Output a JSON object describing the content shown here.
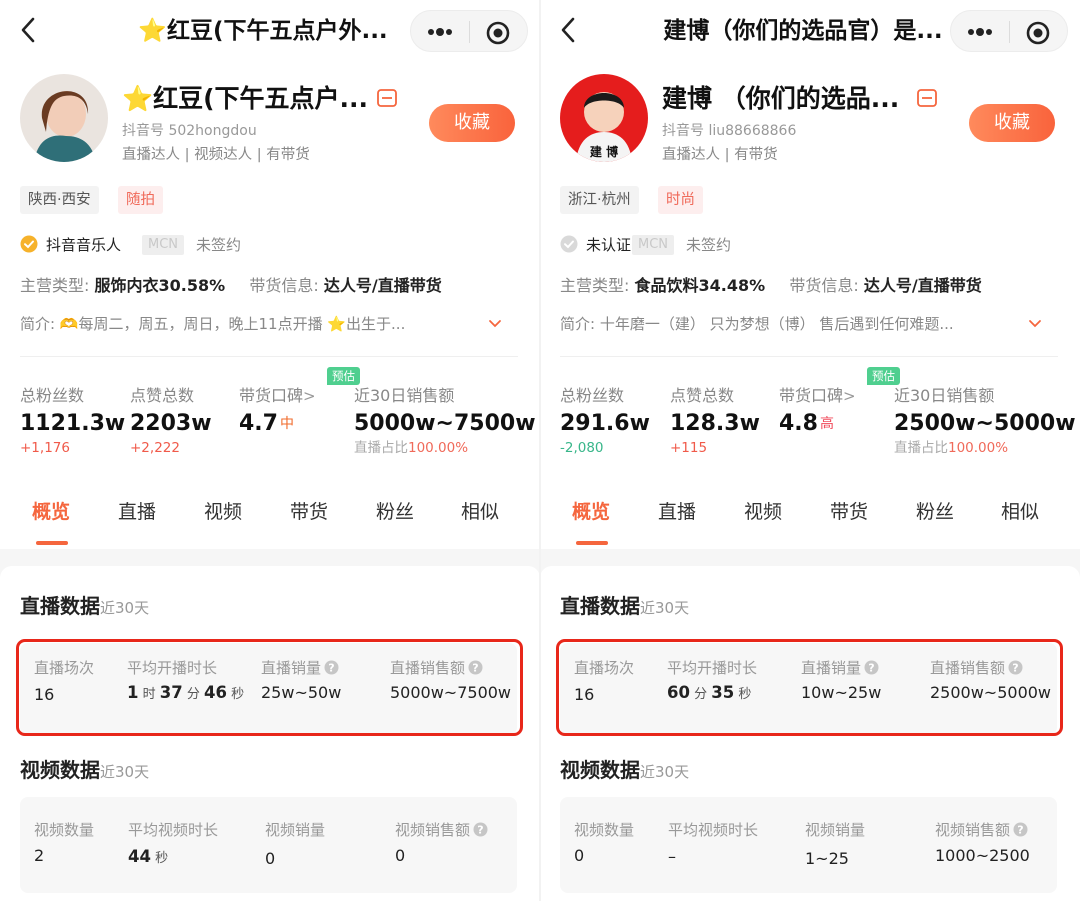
{
  "left": {
    "nav": {
      "title": "⭐红豆(下午五点户外..."
    },
    "profile": {
      "name": "⭐红豆(下午五点户...",
      "douyin_id": "抖音号 502hongdou",
      "roles": "直播达人 | 视频达人 | 有带货",
      "collect_label": "收藏"
    },
    "tags": [
      {
        "label": "陕西·西安",
        "style": "gray"
      },
      {
        "label": "随拍",
        "style": "pink"
      }
    ],
    "certification": {
      "label": "抖音音乐人",
      "verified": true,
      "mcn_badge": "MCN",
      "mcn_status": "未签约"
    },
    "main_category": {
      "label": "主营类型:",
      "value": "服饰内衣30.58%"
    },
    "sales_info": {
      "label": "带货信息:",
      "value": "达人号/直播带货"
    },
    "bio": "简介: 🫶每周二，周五，周日，晚上11点开播 ⭐出生于...",
    "stats": {
      "followers": {
        "label": "总粉丝数",
        "value": "1121.3w",
        "delta": "+1,176",
        "trend": "up"
      },
      "likes": {
        "label": "点赞总数",
        "value": "2203w",
        "delta": "+2,222",
        "trend": "up"
      },
      "rating": {
        "label": "带货口碑",
        "chevron": ">",
        "value": "4.7",
        "level": "中"
      },
      "sales30": {
        "badge": "预估",
        "label": "近30日销售额",
        "value": "5000w~7500w",
        "share_label": "直播占比",
        "share_value": "100.00%"
      }
    },
    "tabs": [
      "概览",
      "直播",
      "视频",
      "带货",
      "粉丝",
      "相似"
    ],
    "active_tab": "概览",
    "live": {
      "title": "直播数据",
      "subtitle": "近30天",
      "metrics": [
        {
          "label": "直播场次",
          "value": "16"
        },
        {
          "label": "平均开播时长",
          "parts": [
            "1",
            "时",
            "37",
            "分",
            "46",
            "秒"
          ]
        },
        {
          "label": "直播销量",
          "value": "25w~50w",
          "help": true
        },
        {
          "label": "直播销售额",
          "value": "5000w~7500w",
          "help": true
        }
      ]
    },
    "video": {
      "title": "视频数据",
      "subtitle": "近30天",
      "metrics": [
        {
          "label": "视频数量",
          "value": "2"
        },
        {
          "label": "平均视频时长",
          "parts": [
            "44",
            "秒"
          ]
        },
        {
          "label": "视频销量",
          "value": "0"
        },
        {
          "label": "视频销售额",
          "value": "0",
          "help": true
        }
      ]
    }
  },
  "right": {
    "nav": {
      "title": "建博（你们的选品官）是..."
    },
    "profile": {
      "name": "建博 （你们的选品...",
      "douyin_id": "抖音号 liu88668866",
      "roles": "直播达人 | 有带货",
      "collect_label": "收藏",
      "avatar_text": "建 博"
    },
    "tags": [
      {
        "label": "浙江·杭州",
        "style": "gray"
      },
      {
        "label": "时尚",
        "style": "pink"
      }
    ],
    "certification": {
      "label": "未认证",
      "verified": false,
      "mcn_badge": "MCN",
      "mcn_status": "未签约"
    },
    "main_category": {
      "label": "主营类型:",
      "value": "食品饮料34.48%"
    },
    "sales_info": {
      "label": "带货信息:",
      "value": "达人号/直播带货"
    },
    "bio": "简介: 十年磨一（建） 只为梦想（博） 售后遇到任何难题...",
    "stats": {
      "followers": {
        "label": "总粉丝数",
        "value": "291.6w",
        "delta": "-2,080",
        "trend": "down"
      },
      "likes": {
        "label": "点赞总数",
        "value": "128.3w",
        "delta": "+115",
        "trend": "up"
      },
      "rating": {
        "label": "带货口碑",
        "chevron": ">",
        "value": "4.8",
        "level": "高"
      },
      "sales30": {
        "badge": "预估",
        "label": "近30日销售额",
        "value": "2500w~5000w",
        "share_label": "直播占比",
        "share_value": "100.00%"
      }
    },
    "tabs": [
      "概览",
      "直播",
      "视频",
      "带货",
      "粉丝",
      "相似"
    ],
    "active_tab": "概览",
    "live": {
      "title": "直播数据",
      "subtitle": "近30天",
      "metrics": [
        {
          "label": "直播场次",
          "value": "16"
        },
        {
          "label": "平均开播时长",
          "parts": [
            "60",
            "分",
            "35",
            "秒"
          ]
        },
        {
          "label": "直播销量",
          "value": "10w~25w",
          "help": true
        },
        {
          "label": "直播销售额",
          "value": "2500w~5000w",
          "help": true
        }
      ]
    },
    "video": {
      "title": "视频数据",
      "subtitle": "近30天",
      "metrics": [
        {
          "label": "视频数量",
          "value": "0"
        },
        {
          "label": "平均视频时长",
          "value": "–"
        },
        {
          "label": "视频销量",
          "value": "1~25"
        },
        {
          "label": "视频销售额",
          "value": "1000~2500",
          "help": true
        }
      ]
    }
  },
  "colors": {
    "accent": "#f5663e",
    "highlight_border": "#e8271a",
    "delta_up": "#f05a4a",
    "delta_down": "#39b68a",
    "estimate_badge": "#4fcf8f"
  }
}
